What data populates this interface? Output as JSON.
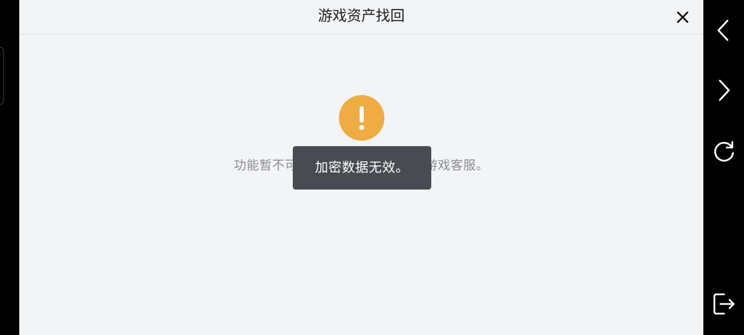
{
  "dialog": {
    "title": "游戏资产找回",
    "close_icon": "close-icon"
  },
  "content": {
    "status_icon": "warning-icon",
    "status_color": "#eeac42",
    "message": "功能暂不可用，请稍后再试或联系游戏客服。"
  },
  "toast": {
    "text": "加密数据无效。"
  },
  "side_nav": {
    "items": [
      "back-icon",
      "forward-icon",
      "refresh-icon",
      "exit-icon"
    ]
  }
}
